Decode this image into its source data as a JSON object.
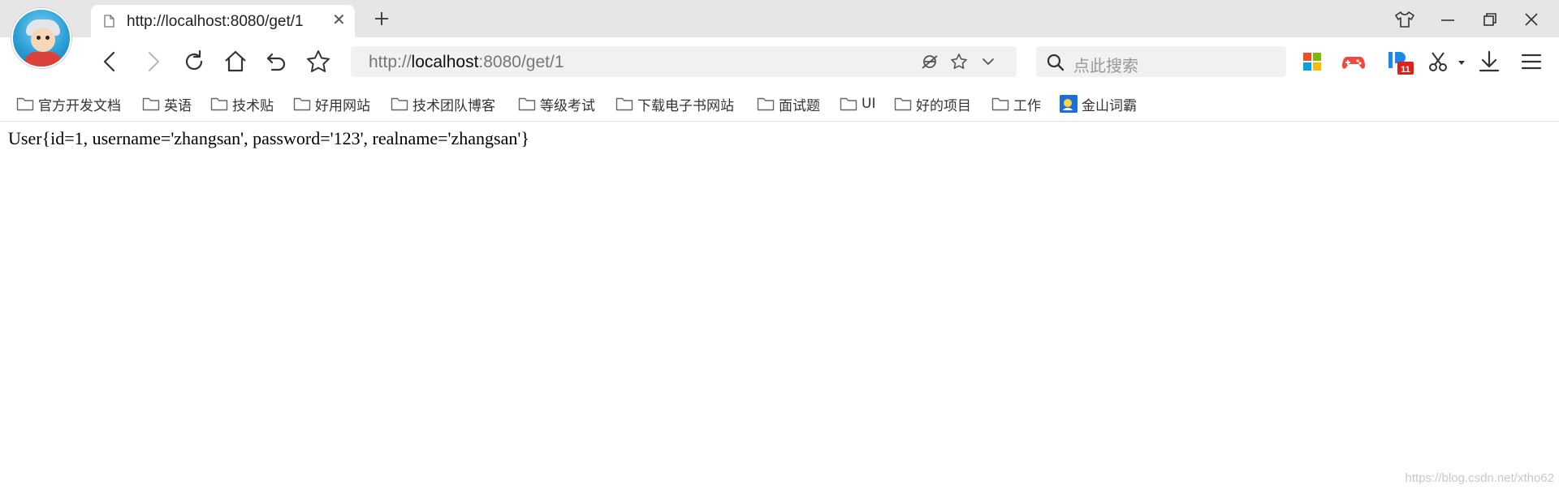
{
  "tab": {
    "title": "http://localhost:8080/get/1",
    "close_glyph": "✕",
    "new_tab_icon": "plus-icon"
  },
  "window_controls": [
    "shirt-icon",
    "minimize-icon",
    "restore-icon",
    "close-icon"
  ],
  "toolbar": {
    "nav_icons": [
      "back-icon",
      "forward-icon",
      "reload-icon",
      "home-icon",
      "undo-icon",
      "favorite-star-icon"
    ],
    "address": {
      "scheme": "http://",
      "host": "localhost",
      "rest": ":8080/get/1"
    },
    "address_icons": [
      "compat-mode-icon",
      "star-icon",
      "chevron-down-icon"
    ],
    "search_placeholder": "点此搜索",
    "extension_icons": [
      "app-grid-icon",
      "game-icon",
      "shopping-icon",
      "scissors-icon",
      "download-icon",
      "menu-icon"
    ]
  },
  "bookmarks": [
    {
      "label": "官方开发文档",
      "icon": "folder-icon"
    },
    {
      "label": "英语",
      "icon": "folder-icon"
    },
    {
      "label": "技术贴",
      "icon": "folder-icon"
    },
    {
      "label": "好用网站",
      "icon": "folder-icon"
    },
    {
      "label": "技术团队博客",
      "icon": "folder-icon"
    },
    {
      "label": "等级考试",
      "icon": "folder-icon"
    },
    {
      "label": "下载电子书网站",
      "icon": "folder-icon"
    },
    {
      "label": "面试题",
      "icon": "folder-icon"
    },
    {
      "label": "UI",
      "icon": "folder-icon"
    },
    {
      "label": "好的项目",
      "icon": "folder-icon"
    },
    {
      "label": "工作",
      "icon": "folder-icon"
    },
    {
      "label": "金山词霸",
      "icon": "iciba-icon"
    }
  ],
  "page": {
    "output": "User{id=1, username='zhangsan', password='123', realname='zhangsan'}"
  },
  "watermark": "https://blog.csdn.net/xtho62",
  "colors": {
    "tabstrip_bg": "#e6e6e6",
    "field_bg": "#f1f1f1",
    "accent_red": "#e0201c"
  }
}
